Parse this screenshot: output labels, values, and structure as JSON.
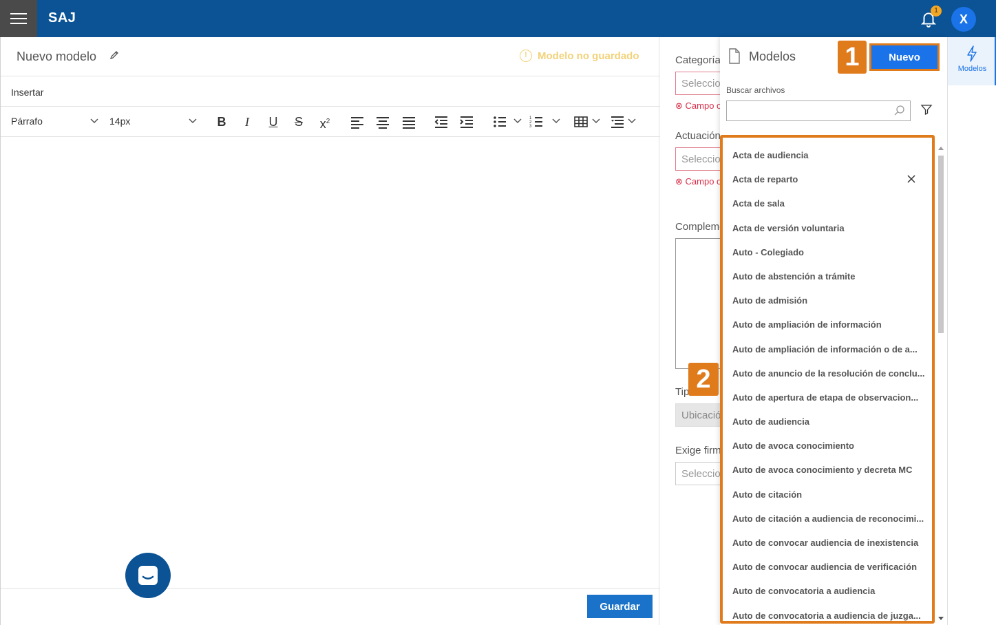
{
  "header": {
    "logo": "SAJ",
    "notification_count": "1",
    "avatar_initial": "X"
  },
  "editor": {
    "title": "Nuevo modelo",
    "status": "Modelo no guardado",
    "insert_label": "Insertar",
    "paragraph_style": "Párrafo",
    "font_size": "14px",
    "save_label": "Guardar"
  },
  "form": {
    "category_label": "Categoría",
    "category_placeholder": "Seleccione",
    "required_error": "Campo obligatorio",
    "action_label": "Actuación",
    "action_placeholder": "Seleccione",
    "complement_label": "Complemento",
    "type_label": "Tipo",
    "location_placeholder": "Ubicación",
    "signature_label": "Exige firma",
    "signature_placeholder": "Seleccione"
  },
  "panel": {
    "title": "Modelos",
    "new_label": "Nuevo",
    "search_label": "Buscar archivos",
    "search_value": "",
    "badge_1": "1",
    "badge_2": "2",
    "items": [
      "Acta de audiencia",
      "Acta de reparto",
      "Acta de sala",
      "Acta de versión voluntaria",
      "Auto - Colegiado",
      "Auto de abstención a trámite",
      "Auto de admisión",
      "Auto de ampliación de información",
      "Auto de ampliación de información o de a...",
      "Auto de anuncio de la resolución de conclu...",
      "Auto de apertura de etapa de observacion...",
      "Auto de audiencia",
      "Auto de avoca conocimiento",
      "Auto de avoca conocimiento y decreta MC",
      "Auto de citación",
      "Auto de citación a audiencia de reconocimi...",
      "Auto de convocar audiencia de inexistencia",
      "Auto de convocar audiencia de verificación",
      "Auto de convocatoria a audiencia",
      "Auto de convocatoria a audiencia de juzga..."
    ]
  },
  "rail": {
    "models_label": "Modelos"
  },
  "colors": {
    "brand": "#0b5394",
    "accent": "#1a73e8",
    "highlight": "#e07b1c",
    "warning": "#f2d27a",
    "error": "#d9304a"
  },
  "icons": [
    "menu-icon",
    "bell-icon",
    "pencil-icon",
    "info-icon",
    "bold-icon",
    "italic-icon",
    "underline-icon",
    "strikethrough-icon",
    "superscript-icon",
    "align-left-icon",
    "align-center-icon",
    "justify-icon",
    "outdent-icon",
    "indent-icon",
    "bullet-list-icon",
    "numbered-list-icon",
    "table-icon",
    "line-height-icon",
    "chat-icon",
    "document-icon",
    "search-icon",
    "filter-icon",
    "close-icon",
    "bolt-icon"
  ]
}
